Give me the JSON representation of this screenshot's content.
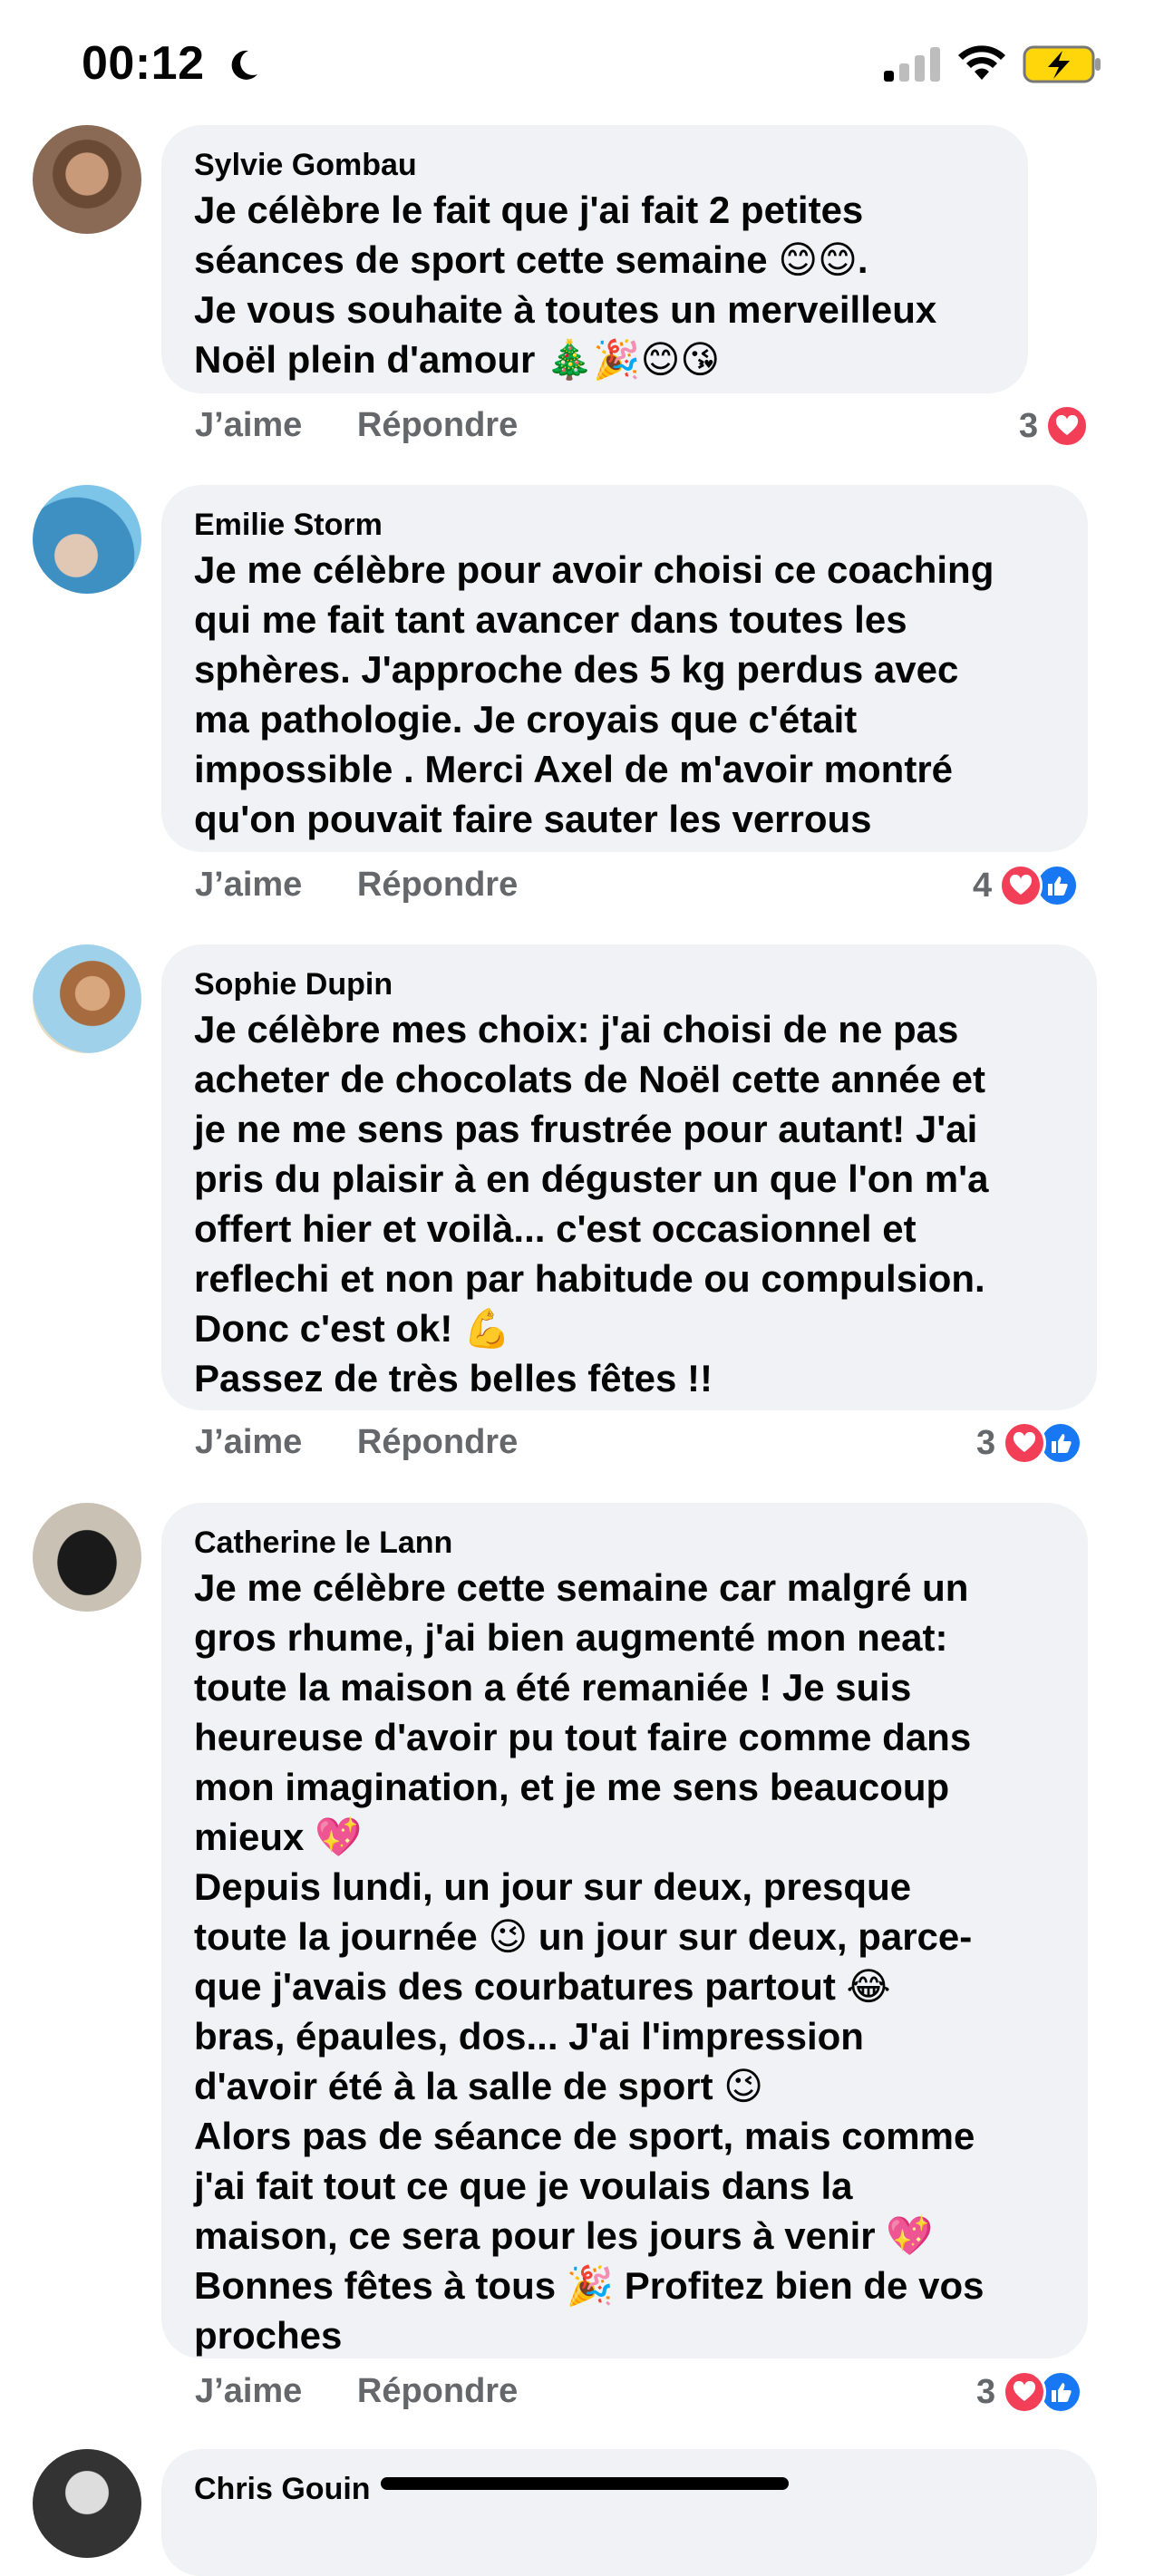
{
  "status_bar": {
    "time": "00:12"
  },
  "actions": {
    "like": "J’aime",
    "reply": "Répondre"
  },
  "comments": [
    {
      "author": "Sylvie Gombau",
      "text": "Je célèbre le fait que j'ai fait 2 petites\nséances de sport cette semaine 😊😊.\nJe vous souhaite à toutes un merveilleux\nNoël plein d'amour 🎄🎉😊😘",
      "reaction_count": "3",
      "reactions": [
        "heart"
      ]
    },
    {
      "author": "Emilie Storm",
      "text": "Je me célèbre pour avoir choisi ce coaching\nqui me fait tant avancer dans toutes les\nsphères.  J'approche des 5 kg perdus avec\nma pathologie. Je croyais que c'était\nimpossible . Merci Axel de m'avoir montré\nqu'on pouvait faire sauter les verrous",
      "reaction_count": "4",
      "reactions": [
        "heart",
        "like"
      ]
    },
    {
      "author": "Sophie Dupin",
      "text": "Je célèbre mes choix: j'ai  choisi de ne pas\nacheter de chocolats de Noël cette année et\nje ne me sens pas frustrée pour autant! J'ai\npris du plaisir à en déguster un que l'on m'a\noffert hier et voilà... c'est occasionnel et\nreflechi et non par habitude ou compulsion.\nDonc c'est ok! 💪\nPassez de très belles fêtes !!",
      "reaction_count": "3",
      "reactions": [
        "heart",
        "like"
      ]
    },
    {
      "author": "Catherine le Lann",
      "text": "Je me célèbre cette semaine car malgré un\ngros rhume, j'ai bien augmenté mon neat:\ntoute la maison a été remaniée ! Je suis\nheureuse d'avoir pu tout faire comme dans\nmon imagination, et je me sens beaucoup\nmieux 💖\nDepuis lundi, un jour sur deux,  presque\ntoute la journée 😉 un jour sur deux, parce-\nque j'avais des courbatures partout 😂\nbras, épaules, dos... J'ai l'impression\nd'avoir été à la salle de sport 😉\nAlors pas de séance de sport, mais comme\nj'ai fait tout ce que je voulais dans la\nmaison, ce sera pour les jours à venir 💖\nBonnes fêtes à tous 🎉 Profitez bien de vos\nproches",
      "reaction_count": "3",
      "reactions": [
        "heart",
        "like"
      ]
    },
    {
      "author": "Chris Gouin"
    }
  ],
  "colors": {
    "bubble": "#f0f2f5",
    "action_text": "#65676b",
    "heart": "#f33e58",
    "like": "#1877f2"
  }
}
